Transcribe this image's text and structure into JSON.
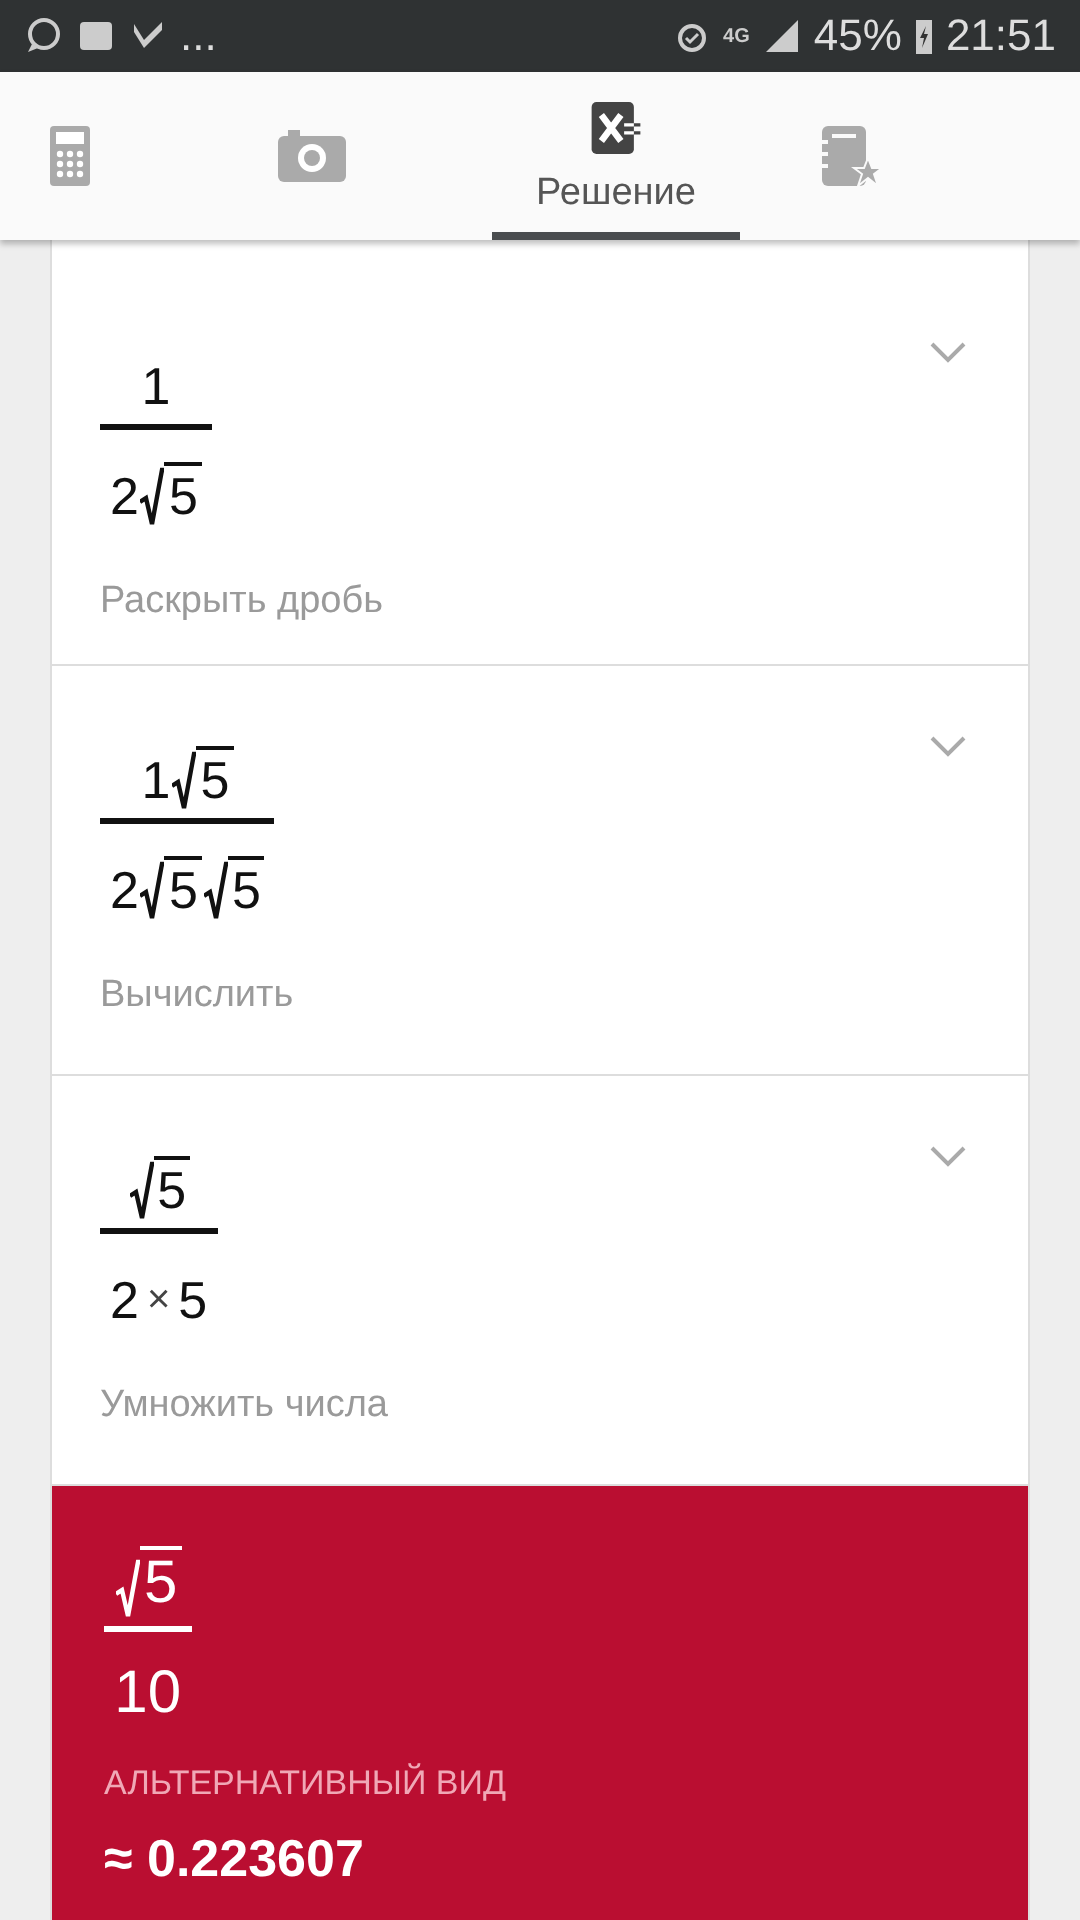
{
  "status_bar": {
    "more": "...",
    "network": "4G",
    "battery": "45%",
    "time": "21:51"
  },
  "tabs": [
    {
      "kind": "calculator",
      "selected": false
    },
    {
      "kind": "camera",
      "selected": false
    },
    {
      "kind": "solution",
      "label": "Решение",
      "selected": true
    },
    {
      "kind": "notebook",
      "selected": false
    }
  ],
  "steps": [
    {
      "numerator": [
        {
          "kind": "num",
          "text": "1"
        }
      ],
      "denominator": [
        {
          "kind": "num",
          "text": "2"
        },
        {
          "kind": "sqrt",
          "text": "5"
        }
      ],
      "caption": "Раскрыть дробь",
      "expanded": false
    },
    {
      "numerator": [
        {
          "kind": "num",
          "text": "1"
        },
        {
          "kind": "sqrt",
          "text": "5"
        }
      ],
      "denominator": [
        {
          "kind": "num",
          "text": "2"
        },
        {
          "kind": "sqrt",
          "text": "5"
        },
        {
          "kind": "sqrt",
          "text": "5"
        }
      ],
      "caption": "Вычислить",
      "expanded": false
    },
    {
      "numerator": [
        {
          "kind": "sqrt",
          "text": "5"
        }
      ],
      "denominator": [
        {
          "kind": "num",
          "text": "2"
        },
        {
          "kind": "op",
          "text": "×"
        },
        {
          "kind": "num",
          "text": "5"
        }
      ],
      "caption": "Умножить числа",
      "expanded": false
    }
  ],
  "result": {
    "numerator": [
      {
        "kind": "sqrt",
        "text": "5"
      }
    ],
    "denominator": [
      {
        "kind": "num",
        "text": "10"
      }
    ],
    "alt_label": "АЛЬТЕРНАТИВНЫЙ ВИД",
    "approx": "≈ 0.223607"
  }
}
